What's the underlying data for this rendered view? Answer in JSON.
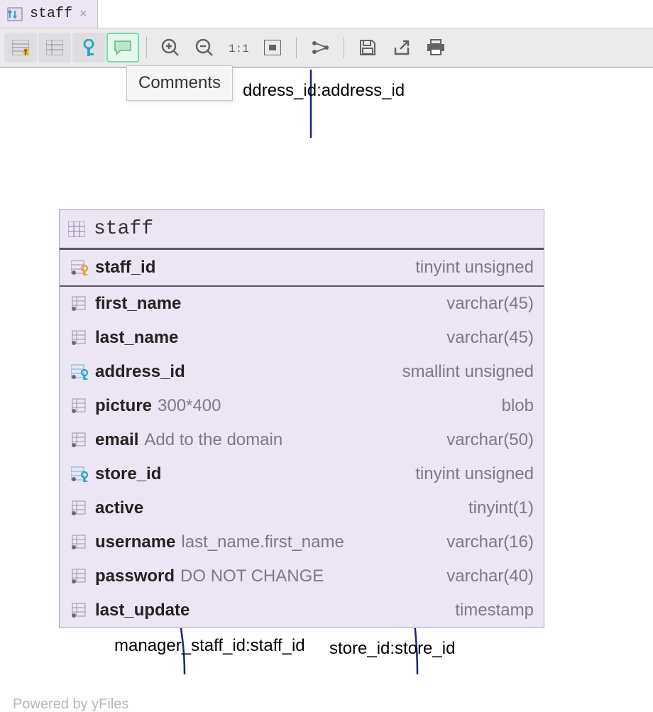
{
  "tab": {
    "label": "staff",
    "close": "×"
  },
  "tooltip": "Comments",
  "relation_top": "ddress_id:address_id",
  "relation_bl": "manager_staff_id:staff_id",
  "relation_br": "store_id:store_id",
  "powered": "Powered by yFiles",
  "table": {
    "name": "staff",
    "columns": [
      {
        "name": "staff_id",
        "note": "",
        "type": "tinyint unsigned",
        "kind": "pk"
      },
      {
        "name": "first_name",
        "note": "",
        "type": "varchar(45)",
        "kind": "col"
      },
      {
        "name": "last_name",
        "note": "",
        "type": "varchar(45)",
        "kind": "col"
      },
      {
        "name": "address_id",
        "note": "",
        "type": "smallint unsigned",
        "kind": "fk"
      },
      {
        "name": "picture",
        "note": "300*400",
        "type": "blob",
        "kind": "col"
      },
      {
        "name": "email",
        "note": "Add to the domain",
        "type": "varchar(50)",
        "kind": "col"
      },
      {
        "name": "store_id",
        "note": "",
        "type": "tinyint unsigned",
        "kind": "fk"
      },
      {
        "name": "active",
        "note": "",
        "type": "tinyint(1)",
        "kind": "col"
      },
      {
        "name": "username",
        "note": "last_name.first_name",
        "type": "varchar(16)",
        "kind": "col"
      },
      {
        "name": "password",
        "note": "DO NOT CHANGE",
        "type": "varchar(40)",
        "kind": "col"
      },
      {
        "name": "last_update",
        "note": "",
        "type": "timestamp",
        "kind": "col"
      }
    ]
  }
}
